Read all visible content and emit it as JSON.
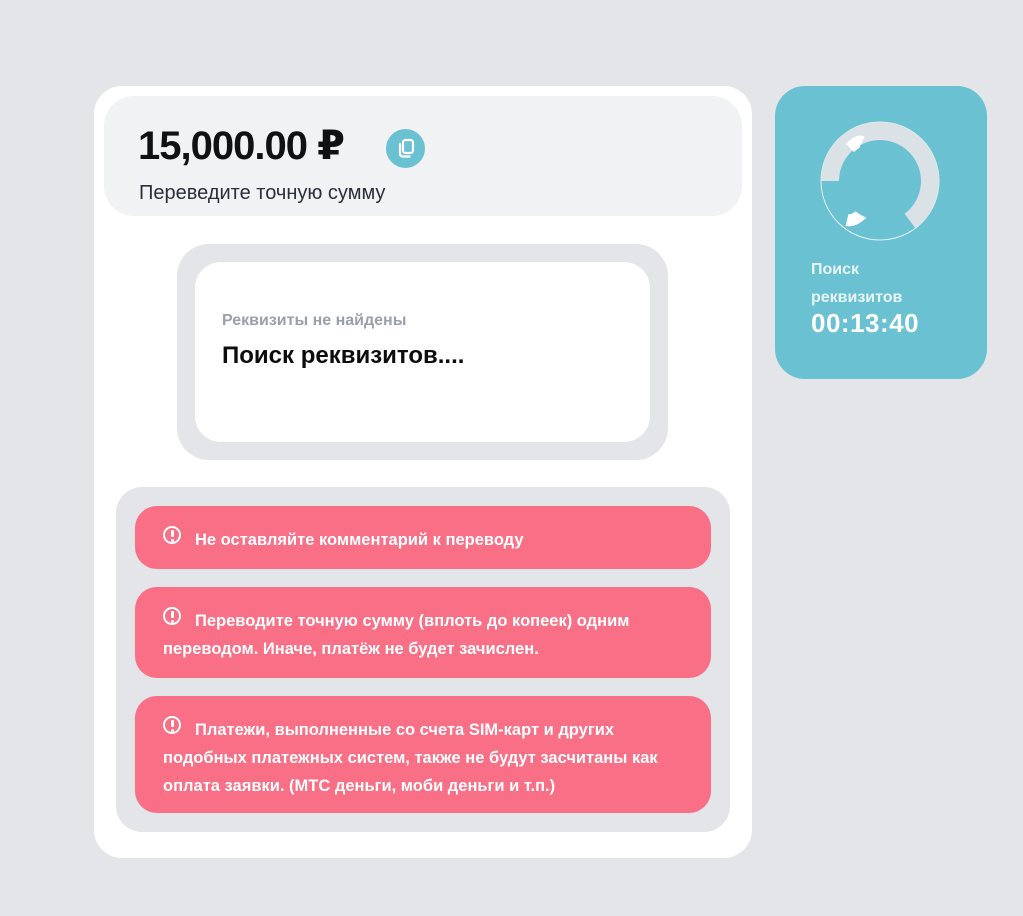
{
  "payment": {
    "amount": "15,000.00 ₽",
    "amount_hint": "Переведите точную сумму",
    "copy_icon": "copy-icon"
  },
  "requisites": {
    "status": "Реквизиты не найдены",
    "title": "Поиск реквизитов...."
  },
  "warnings": [
    {
      "icon": "exclamation-circle-icon",
      "text": "Не оставляйте комментарий к переводу"
    },
    {
      "icon": "exclamation-circle-icon",
      "text": "Переводите точную сумму (вплоть до копеек) одним переводом. Иначе, платёж не будет зачислен."
    },
    {
      "icon": "exclamation-circle-icon",
      "text": "Платежи, выполненные со счета SIM-карт и других подобных платежных систем, также не будут засчитаны как оплата заявки. (МТС деньги, моби деньги и т.п.)"
    }
  ],
  "search_panel": {
    "label": "Поиск реквизитов",
    "timer": "00:13:40",
    "spinner_icon": "loading-spinner-icon"
  },
  "colors": {
    "accent": "#69c1d2",
    "warning": "#f86f86",
    "background": "#e4e5e8"
  }
}
